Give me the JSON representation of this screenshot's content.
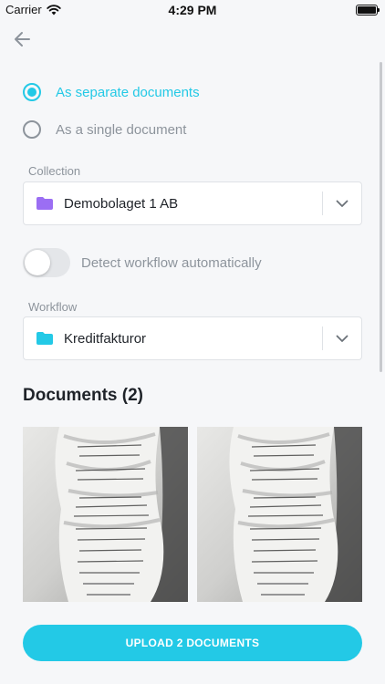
{
  "status_bar": {
    "carrier": "Carrier",
    "time": "4:29 PM"
  },
  "options": {
    "separate": {
      "label": "As separate documents",
      "selected": true
    },
    "single": {
      "label": "As a single document",
      "selected": false
    }
  },
  "collection": {
    "label": "Collection",
    "value": "Demobolaget 1 AB",
    "folder_color": "#9b6ef3"
  },
  "detect_workflow": {
    "label": "Detect workflow automatically",
    "enabled": false
  },
  "workflow": {
    "label": "Workflow",
    "value": "Kreditfakturor",
    "folder_color": "#23c9e6"
  },
  "documents": {
    "title": "Documents (2)",
    "items": [
      {
        "type": "receipt-photo"
      },
      {
        "type": "receipt-photo"
      }
    ]
  },
  "upload_button": {
    "label": "UPLOAD 2 DOCUMENTS"
  },
  "colors": {
    "accent": "#23c9e6",
    "background": "#f6f7f9",
    "muted_text": "#8d949c"
  }
}
